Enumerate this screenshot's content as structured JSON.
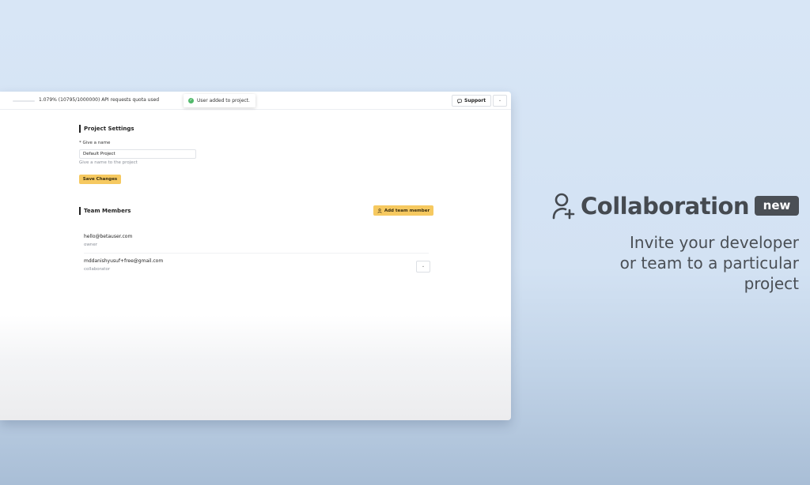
{
  "topbar": {
    "quota_text": "1.079% (10795/1000000) API requests quota used",
    "quota_percent": 1.079,
    "toast_text": "User added to project.",
    "support_label": "Support",
    "menu_icon": "chevron-down-icon"
  },
  "project_settings": {
    "title": "Project Settings",
    "name_label": "* Give a name",
    "name_value": "Default Project",
    "name_help": "Give a name to the project",
    "save_label": "Save Changes"
  },
  "team": {
    "title": "Team Members",
    "add_label": "Add team member",
    "members": [
      {
        "email": "hello@betauser.com",
        "role": "owner"
      },
      {
        "email": "mddanishyusuf+free@gmail.com",
        "role": "collaborator"
      }
    ]
  },
  "promo": {
    "title": "Collaboration",
    "badge": "new",
    "subtitle_lines": [
      "Invite your developer",
      "or team to a particular",
      "project"
    ]
  },
  "colors": {
    "accent": "#f6c960",
    "success": "#52b96b",
    "badge_bg": "#4a4f55",
    "background": "#d8e6f6"
  }
}
